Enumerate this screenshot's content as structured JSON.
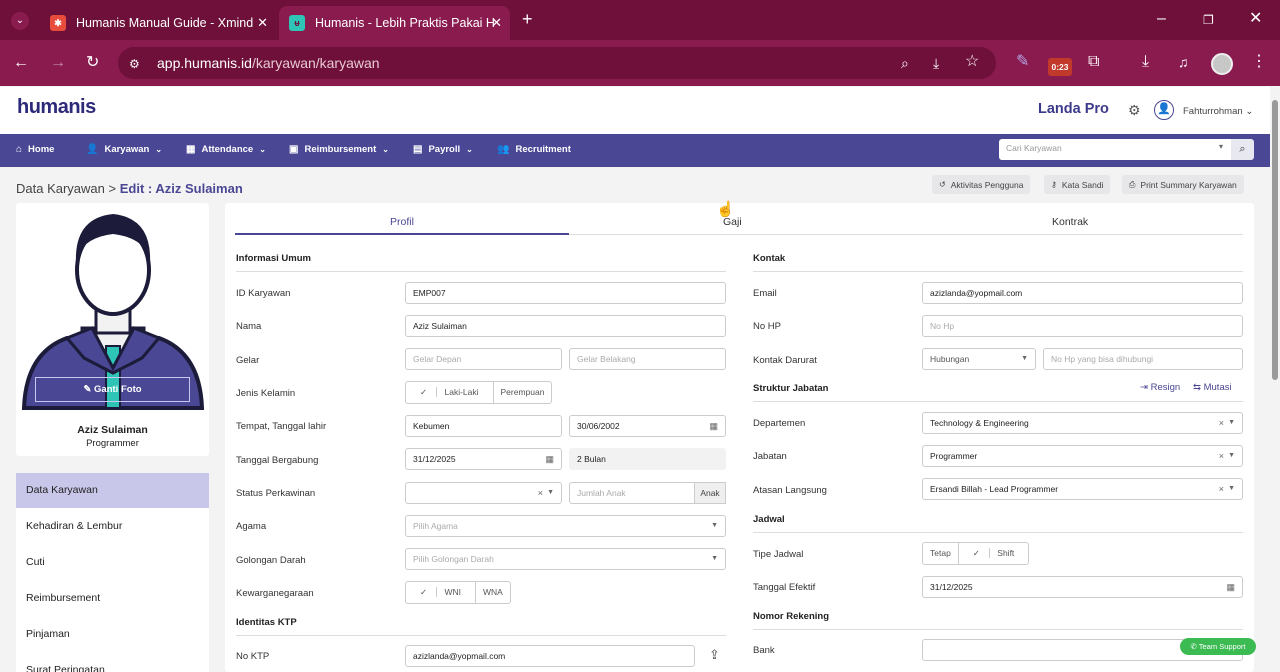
{
  "browser": {
    "tabs": [
      {
        "title": "Humanis Manual Guide - Xmind"
      },
      {
        "title": "Humanis - Lebih Praktis Pakai H"
      }
    ],
    "url_host": "app.humanis.id",
    "url_path": "/karyawan/karyawan",
    "timer_badge": "0:23"
  },
  "app": {
    "logo": "humanis",
    "plan": "Landa Pro",
    "user": "Fahturrohman",
    "nav": [
      "Home",
      "Karyawan",
      "Attendance",
      "Reimbursement",
      "Payroll",
      "Recruitment"
    ],
    "search_placeholder": "Cari Karyawan"
  },
  "breadcrumb": {
    "root": "Data Karyawan",
    "sep": ">",
    "current": "Edit : Aziz Sulaiman"
  },
  "actions": [
    "Aktivitas Pengguna",
    "Kata Sandi",
    "Print Summary Karyawan"
  ],
  "profile": {
    "change_photo": "Ganti Foto",
    "name": "Aziz Sulaiman",
    "role": "Programmer",
    "menu": [
      "Data Karyawan",
      "Kehadiran & Lembur",
      "Cuti",
      "Reimbursement",
      "Pinjaman",
      "Surat Peringatan"
    ]
  },
  "tabs": [
    "Profil",
    "Gaji",
    "Kontrak"
  ],
  "left_form": {
    "section_general": "Informasi Umum",
    "id_label": "ID Karyawan",
    "id_value": "EMP007",
    "name_label": "Nama",
    "name_value": "Aziz Sulaiman",
    "title_label": "Gelar",
    "title_front_ph": "Gelar Depan",
    "title_back_ph": "Gelar Belakang",
    "gender_label": "Jenis Kelamin",
    "gender_male": "Laki-Laki",
    "gender_female": "Perempuan",
    "birth_label": "Tempat, Tanggal lahir",
    "birth_place": "Kebumen",
    "birth_date": "30/06/2002",
    "join_label": "Tanggal Bergabung",
    "join_date": "31/12/2025",
    "join_duration": "2 Bulan",
    "marital_label": "Status Perkawinan",
    "children_ph": "Jumlah Anak",
    "children_addon": "Anak",
    "religion_label": "Agama",
    "religion_ph": "Pilih Agama",
    "blood_label": "Golongan Darah",
    "blood_ph": "Pilih Golongan Darah",
    "citizenship_label": "Kewarganegaraan",
    "wni": "WNI",
    "wna": "WNA",
    "section_ktp": "Identitas KTP",
    "ktp_label": "No KTP",
    "ktp_value": "azizlanda@yopmail.com"
  },
  "right_form": {
    "section_contact": "Kontak",
    "email_label": "Email",
    "email_value": "azizlanda@yopmail.com",
    "phone_label": "No HP",
    "phone_ph": "No Hp",
    "emergency_label": "Kontak Darurat",
    "relation_ph": "Hubungan",
    "emergency_ph": "No Hp yang bisa dihubungi",
    "section_structure": "Struktur Jabatan",
    "resign": "Resign",
    "mutasi": "Mutasi",
    "dept_label": "Departemen",
    "dept_value": "Technology & Engineering",
    "position_label": "Jabatan",
    "position_value": "Programmer",
    "manager_label": "Atasan Langsung",
    "manager_value": "Ersandi Billah - Lead Programmer",
    "section_schedule": "Jadwal",
    "schedule_type_label": "Tipe Jadwal",
    "fixed": "Tetap",
    "shift": "Shift",
    "effective_label": "Tanggal Efektif",
    "effective_date": "31/12/2025",
    "section_bank": "Nomor Rekening",
    "bank_label": "Bank"
  },
  "support": "Team Support"
}
